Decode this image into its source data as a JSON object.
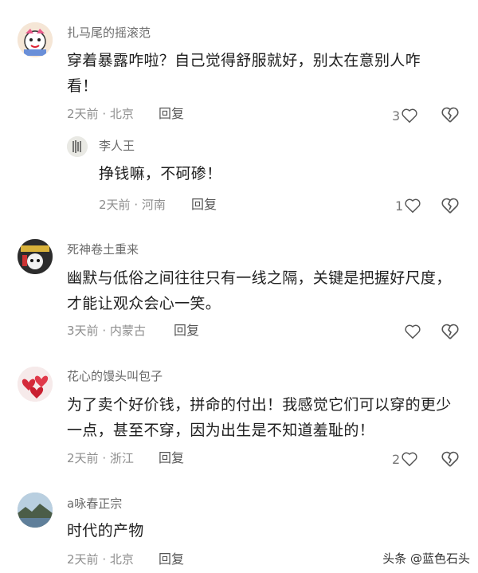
{
  "comments": [
    {
      "username": "扎马尾的摇滚范",
      "text": "穿着暴露咋啦？自己觉得舒服就好，别太在意别人咋看！",
      "time": "2天前",
      "location": "北京",
      "reply_label": "回复",
      "likes": "3",
      "sub_reply": {
        "username": "李人王",
        "text": "挣钱嘛，不砢碜！",
        "time": "2天前",
        "location": "河南",
        "reply_label": "回复",
        "likes": "1"
      }
    },
    {
      "username": "死神卷土重来",
      "text": "幽默与低俗之间往往只有一线之隔，关键是把握好尺度，才能让观众会心一笑。",
      "time": "3天前",
      "location": "内蒙古",
      "reply_label": "回复",
      "likes": ""
    },
    {
      "username": "花心的馒头叫包子",
      "text": "为了卖个好价钱，拼命的付出！我感觉它们可以穿的更少一点，甚至不穿，因为出生是不知道羞耻的！",
      "time": "2天前",
      "location": "浙江",
      "reply_label": "回复",
      "likes": "2"
    },
    {
      "username": "a咏春正宗",
      "text": "时代的产物",
      "time": "2天前",
      "location": "北京",
      "reply_label": "回复",
      "likes": ""
    }
  ],
  "meta_separator": " · ",
  "watermark": "头条 @蓝色石头",
  "colors": {
    "text": "#1f1f1f",
    "meta": "#8e8e8e",
    "username": "#6b6b6b",
    "icon": "#555555"
  }
}
